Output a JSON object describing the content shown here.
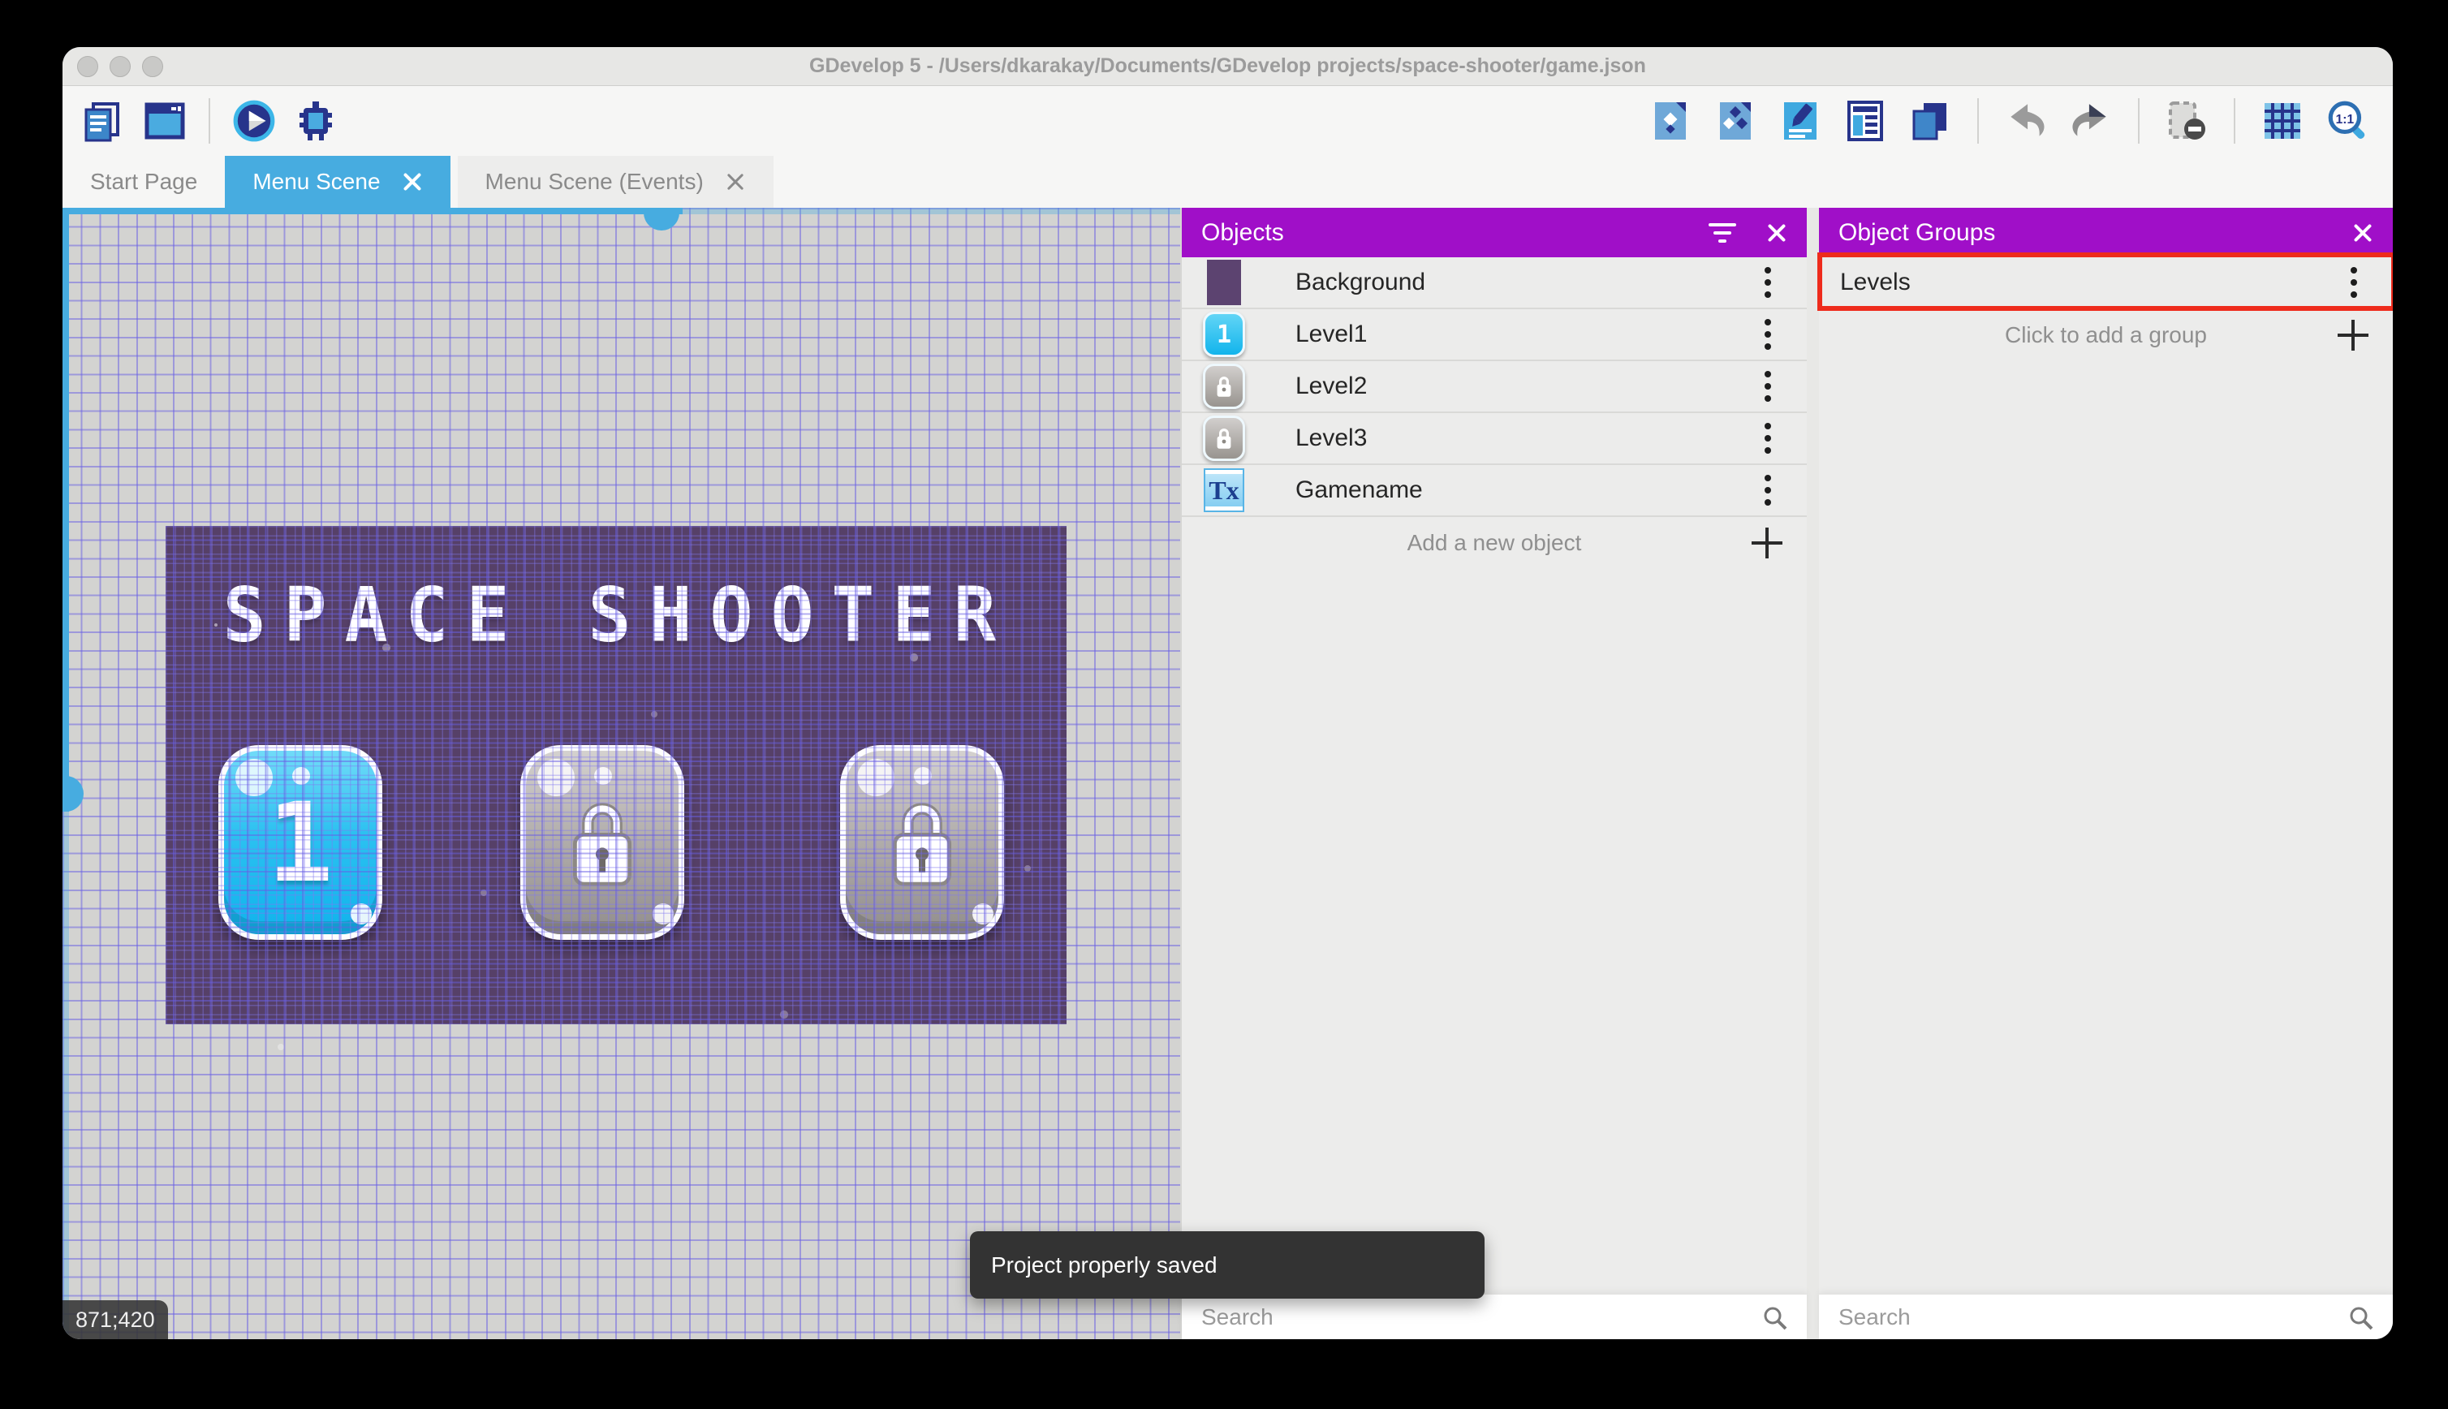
{
  "window": {
    "title": "GDevelop 5 - /Users/dkarakay/Documents/GDevelop projects/space-shooter/game.json"
  },
  "toolbar": {
    "left_icons": [
      "project-manager-icon",
      "scene-editor-icon",
      "play-icon",
      "debug-icon"
    ],
    "right_icons": [
      "objects-editor-icon",
      "object-groups-icon",
      "properties-icon",
      "instances-list-icon",
      "layers-icon",
      "undo-icon",
      "redo-icon",
      "toggle-mask-icon",
      "grid-icon",
      "zoom-1-1-icon"
    ],
    "zoom_ratio_label": "1:1"
  },
  "tabs": [
    {
      "label": "Start Page",
      "active": false,
      "closable": false
    },
    {
      "label": "Menu Scene",
      "active": true,
      "closable": true
    },
    {
      "label": "Menu Scene (Events)",
      "active": false,
      "closable": true
    }
  ],
  "canvas": {
    "scene_title": "SPACE SHOOTER",
    "level_buttons": [
      {
        "label": "1",
        "state": "unlocked"
      },
      {
        "label": "",
        "state": "locked"
      },
      {
        "label": "",
        "state": "locked"
      }
    ],
    "cursor_coordinates": "871;420"
  },
  "objects_panel": {
    "title": "Objects",
    "items": [
      {
        "name": "Background",
        "thumb": "purple-rectangle",
        "thumb_label": ""
      },
      {
        "name": "Level1",
        "thumb": "blue-button",
        "thumb_label": "1"
      },
      {
        "name": "Level2",
        "thumb": "locked-button",
        "thumb_label": ""
      },
      {
        "name": "Level3",
        "thumb": "locked-button",
        "thumb_label": ""
      },
      {
        "name": "Gamename",
        "thumb": "text-object",
        "thumb_label": "Tx"
      }
    ],
    "add_label": "Add a new object",
    "search_placeholder": "Search"
  },
  "object_groups_panel": {
    "title": "Object Groups",
    "items": [
      {
        "name": "Levels",
        "highlighted": true
      }
    ],
    "add_label": "Click to add a group",
    "search_placeholder": "Search"
  },
  "toast": {
    "message": "Project properly saved"
  },
  "colors": {
    "accent_blue": "#47ace0",
    "header_purple": "#a00fc8",
    "highlight_red": "#ee2b1c",
    "scene_purple": "#564068"
  }
}
